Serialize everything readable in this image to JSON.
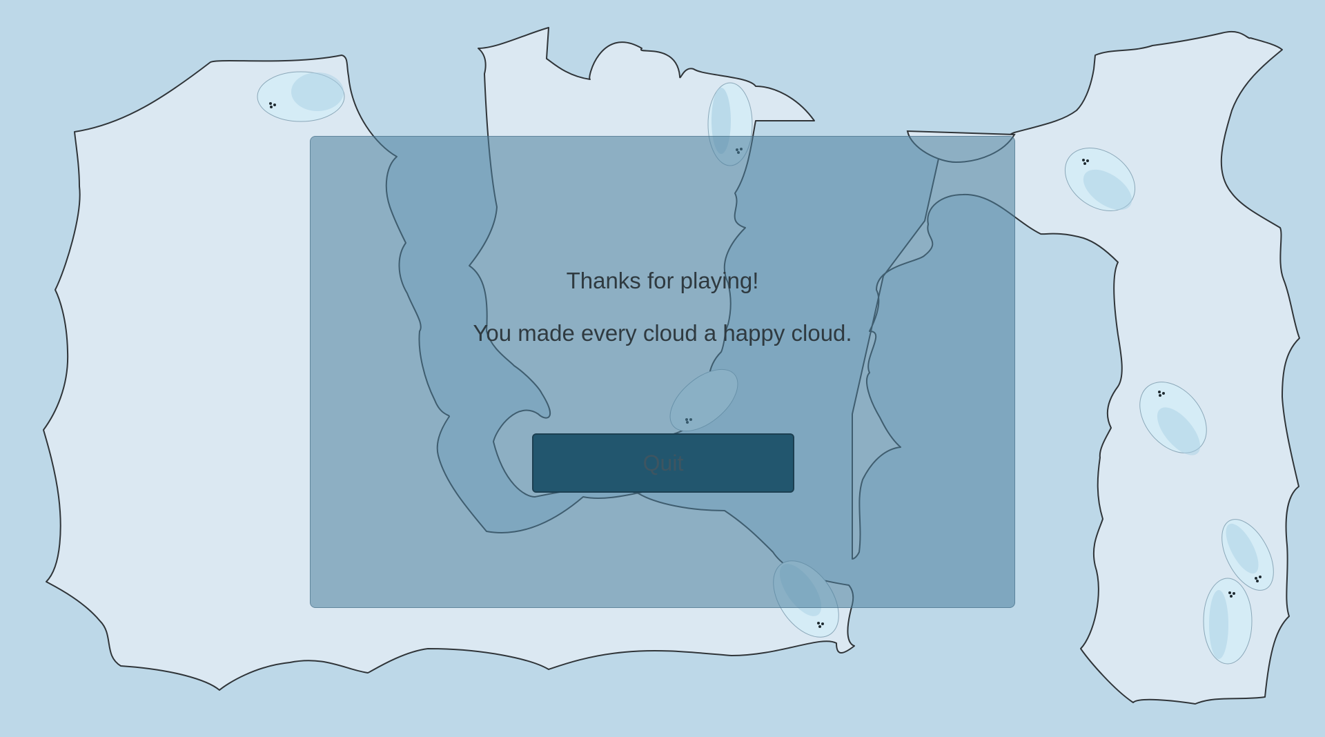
{
  "end_screen": {
    "title": "Thanks for playing!",
    "message": "You made every cloud a happy cloud.",
    "quit_label": "Quit"
  },
  "colors": {
    "sky": "#bdd8e8",
    "cloud_fill": "#dbe8f2",
    "cloud_stroke": "#2f3438",
    "small_cloud_fill": "#d5ecf6",
    "small_cloud_shade": "#a9cfe3",
    "dialog_overlay": "#4d809d",
    "quit_button": "#22566e",
    "text": "#2f3a40"
  }
}
